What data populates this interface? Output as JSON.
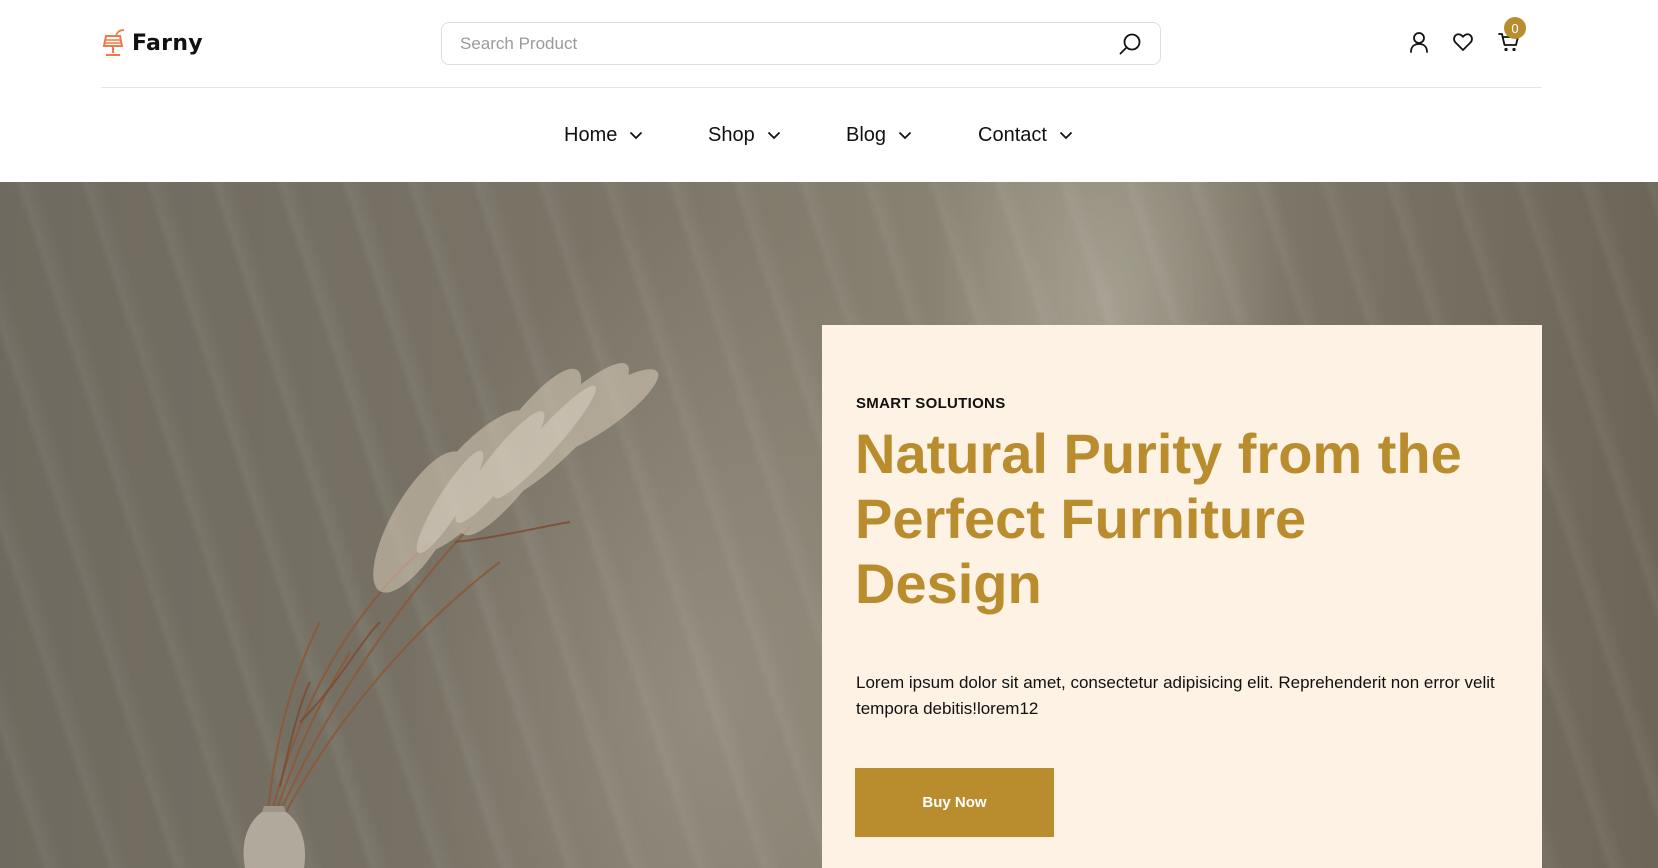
{
  "brand": {
    "name": "Farny",
    "accent_color": "#b98d2e",
    "logo_icon": "lamp-logo-icon"
  },
  "search": {
    "placeholder": "Search Product",
    "value": "",
    "icon": "search-icon"
  },
  "header_actions": {
    "account_icon": "user-icon",
    "wishlist_icon": "heart-icon",
    "cart_icon": "cart-icon",
    "cart_count": "0"
  },
  "nav": {
    "items": [
      {
        "label": "Home",
        "icon": "chevron-down-icon"
      },
      {
        "label": "Shop",
        "icon": "chevron-down-icon"
      },
      {
        "label": "Blog",
        "icon": "chevron-down-icon"
      },
      {
        "label": "Contact",
        "icon": "chevron-down-icon"
      }
    ]
  },
  "hero": {
    "eyebrow": "SMART SOLUTIONS",
    "headline": "Natural Purity from the Perfect Furniture Design",
    "description": "Lorem ipsum dolor sit amet, consectetur adipisicing elit. Reprehenderit non error velit tempora debitis!lorem12",
    "cta_label": "Buy Now",
    "card_background": "#fdf2e3"
  }
}
